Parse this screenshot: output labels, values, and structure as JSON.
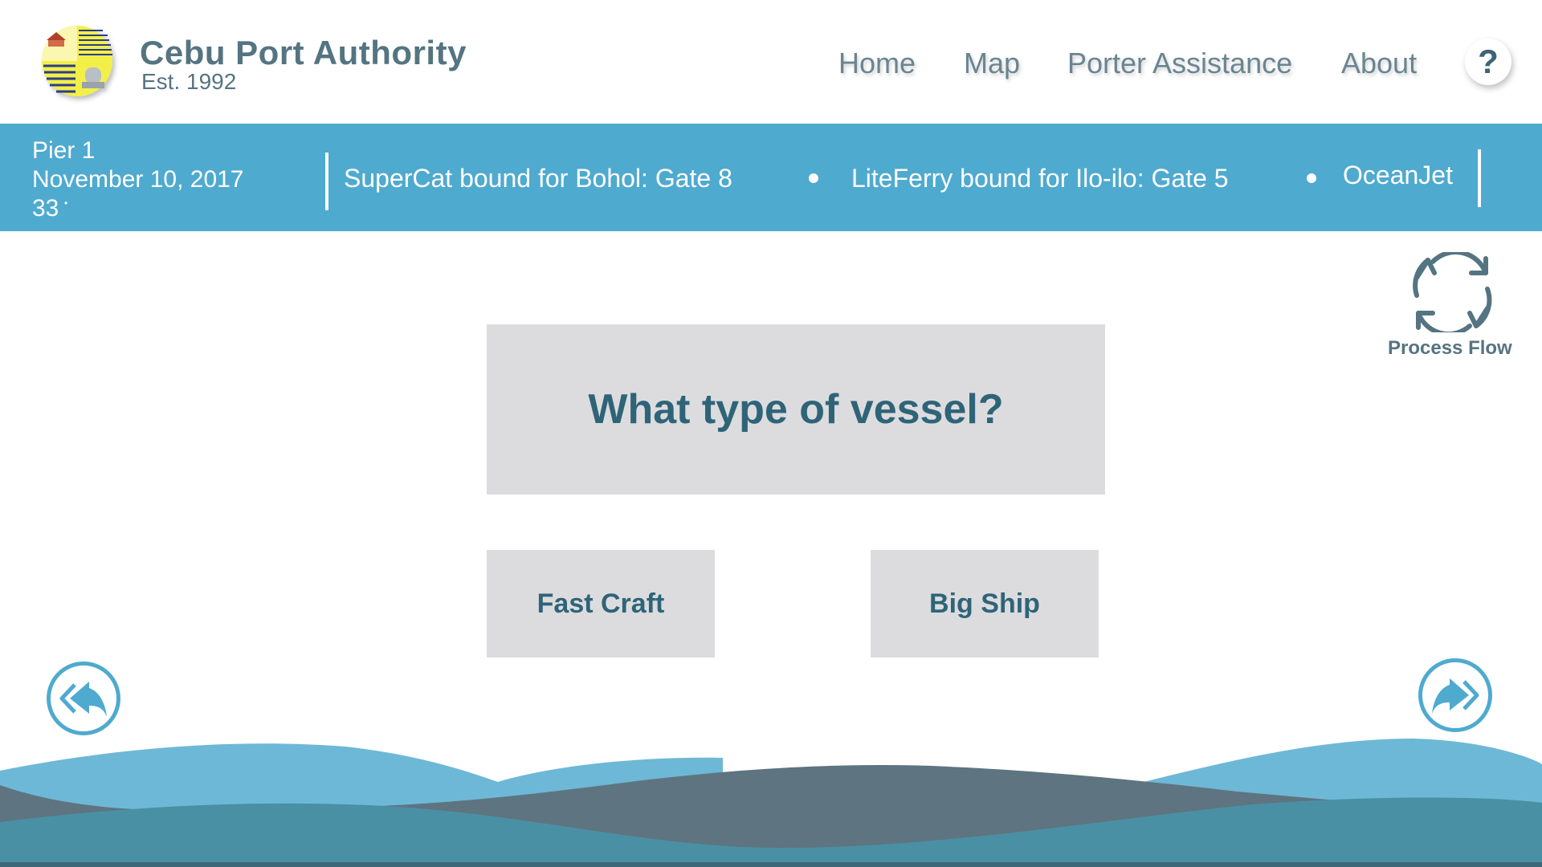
{
  "header": {
    "brand_title": "Cebu Port Authority",
    "brand_subtitle": "Est. 1992",
    "nav": {
      "home": "Home",
      "map": "Map",
      "porter": "Porter Assistance",
      "about": "About"
    },
    "help_label": "?"
  },
  "infobar": {
    "pier": "Pier 1",
    "date": "November 10, 2017",
    "temperature": "33",
    "temperature_unit": "•",
    "ticker": [
      "SuperCat bound for Bohol: Gate 8",
      "LiteFerry bound for Ilo-ilo: Gate 5",
      "OceanJet"
    ]
  },
  "process_flow": {
    "label": "Process Flow",
    "icon": "refresh-cycle-icon"
  },
  "main": {
    "question": "What type of vessel?",
    "options": [
      "Fast Craft",
      "Big Ship"
    ]
  },
  "navigation": {
    "back_icon": "reply-back-icon",
    "forward_icon": "forward-icon"
  },
  "colors": {
    "accent": "#4faacf",
    "text_dark": "#2f6478",
    "card_bg": "#dcdcdf",
    "wave_light": "#6db8d6",
    "wave_dark": "#5e7480",
    "wave_teal": "#4a90a4"
  }
}
